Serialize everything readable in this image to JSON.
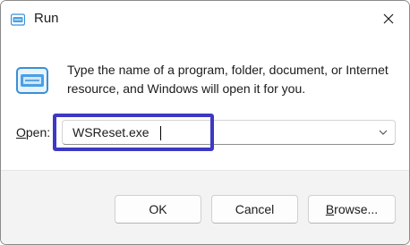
{
  "window": {
    "title": "Run",
    "close_icon": "close-icon"
  },
  "dialog": {
    "description": "Type the name of a program, folder, document, or Internet resource, and Windows will open it for you.",
    "open_label_accel": "O",
    "open_label_rest": "pen:",
    "open_value": "WSReset.exe"
  },
  "buttons": {
    "ok": "OK",
    "cancel": "Cancel",
    "browse_accel": "B",
    "browse_rest": "rowse..."
  },
  "colors": {
    "highlight": "#3d39c4",
    "icon_blue": "#3a8fd6"
  }
}
